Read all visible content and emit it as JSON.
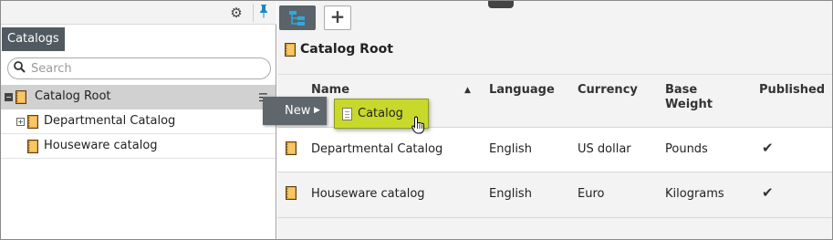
{
  "left_panel": {
    "tab_label": "Catalogs",
    "search_placeholder": "Search",
    "tree": [
      {
        "label": "Catalog Root",
        "expanded": true,
        "selected": true
      },
      {
        "label": "Departmental Catalog",
        "expanded": false
      },
      {
        "label": "Houseware catalog"
      }
    ],
    "icons": {
      "settings": "gear-icon",
      "pin": "pin-icon",
      "search": "search-icon",
      "node": "book-icon"
    }
  },
  "right_panel": {
    "toolbar": {
      "tree_view": "tree-view-icon",
      "add": "+"
    },
    "breadcrumb": "Catalog Root",
    "columns": [
      {
        "label": "Name"
      },
      {
        "label": "Language"
      },
      {
        "label": "Currency"
      },
      {
        "label": "Base Weight"
      },
      {
        "label": "Published"
      }
    ],
    "rows": [
      {
        "name": "Departmental Catalog",
        "language": "English",
        "currency": "US dollar",
        "base_weight": "Pounds",
        "published": "✔"
      },
      {
        "name": "Houseware catalog",
        "language": "English",
        "currency": "Euro",
        "base_weight": "Kilograms",
        "published": "✔"
      }
    ]
  },
  "context_menu": {
    "new_label": "New",
    "submenu_item": "Catalog"
  },
  "colors": {
    "selected_row": "#d1d1d1",
    "menu_dark": "#5f676c",
    "menu_highlight": "#c8d92b",
    "pin_accent": "#1b86c9"
  }
}
